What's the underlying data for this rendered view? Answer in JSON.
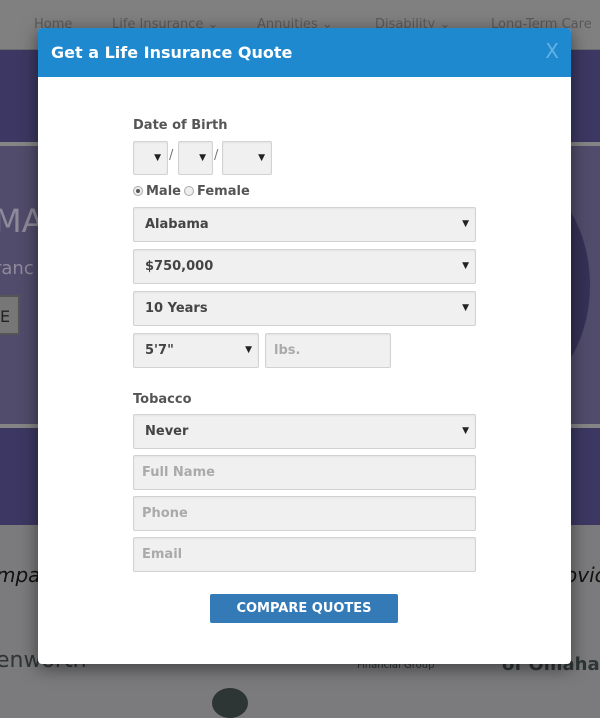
{
  "nav": {
    "items": [
      "Home",
      "Life Insurance",
      "Annuities",
      "Disability",
      "Long-Term Care"
    ]
  },
  "hero": {
    "title_fragment": "MA",
    "subtitle_fragment": "ranc",
    "button_fragment": "E"
  },
  "lower": {
    "left_text": "mpa",
    "right_text": "ovic",
    "logos": [
      "enworth",
      "Financial Group",
      "of Omaha"
    ]
  },
  "modal": {
    "title": "Get a Life Insurance Quote",
    "close_label": "X",
    "dob_label": "Date of Birth",
    "dob_separator": "/",
    "gender": {
      "male": "Male",
      "female": "Female",
      "selected": "Male"
    },
    "state": "Alabama",
    "coverage": "$750,000",
    "term": "10 Years",
    "height": "5'7\"",
    "weight_placeholder": "lbs.",
    "tobacco_label": "Tobacco",
    "tobacco": "Never",
    "name_placeholder": "Full Name",
    "phone_placeholder": "Phone",
    "email_placeholder": "Email",
    "submit": "COMPARE QUOTES"
  },
  "colors": {
    "header": "#1f89d0",
    "button": "#337ab7"
  }
}
